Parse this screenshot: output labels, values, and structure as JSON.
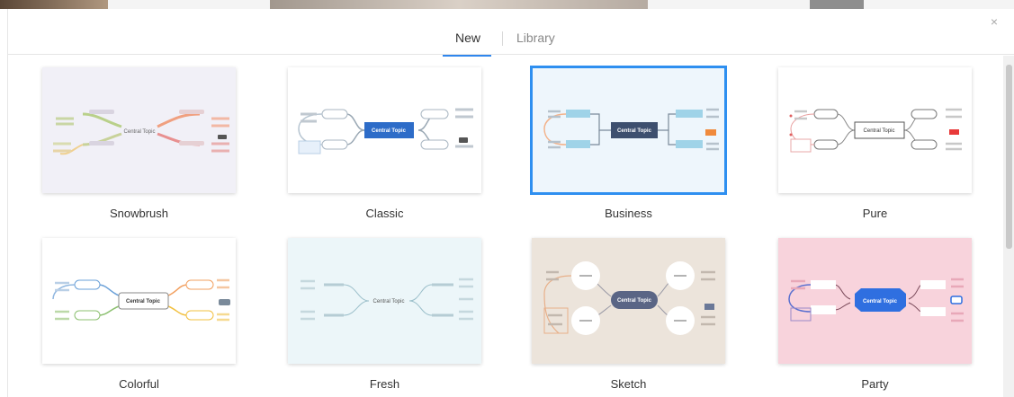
{
  "dialog": {
    "close_glyph": "×",
    "tabs": [
      {
        "label": "New",
        "active": true
      },
      {
        "label": "Library",
        "active": false
      }
    ],
    "accent_color": "#2f86ed"
  },
  "themes": [
    {
      "name": "Snowbrush",
      "central": "Central Topic",
      "selected": false
    },
    {
      "name": "Classic",
      "central": "Central Topic",
      "selected": false
    },
    {
      "name": "Business",
      "central": "Central Topic",
      "selected": true
    },
    {
      "name": "Pure",
      "central": "Central Topic",
      "selected": false
    },
    {
      "name": "Colorful",
      "central": "Central Topic",
      "selected": false
    },
    {
      "name": "Fresh",
      "central": "Central Topic",
      "selected": false
    },
    {
      "name": "Sketch",
      "central": "Central Topic",
      "selected": false
    },
    {
      "name": "Party",
      "central": "Central Topic",
      "selected": false
    }
  ]
}
